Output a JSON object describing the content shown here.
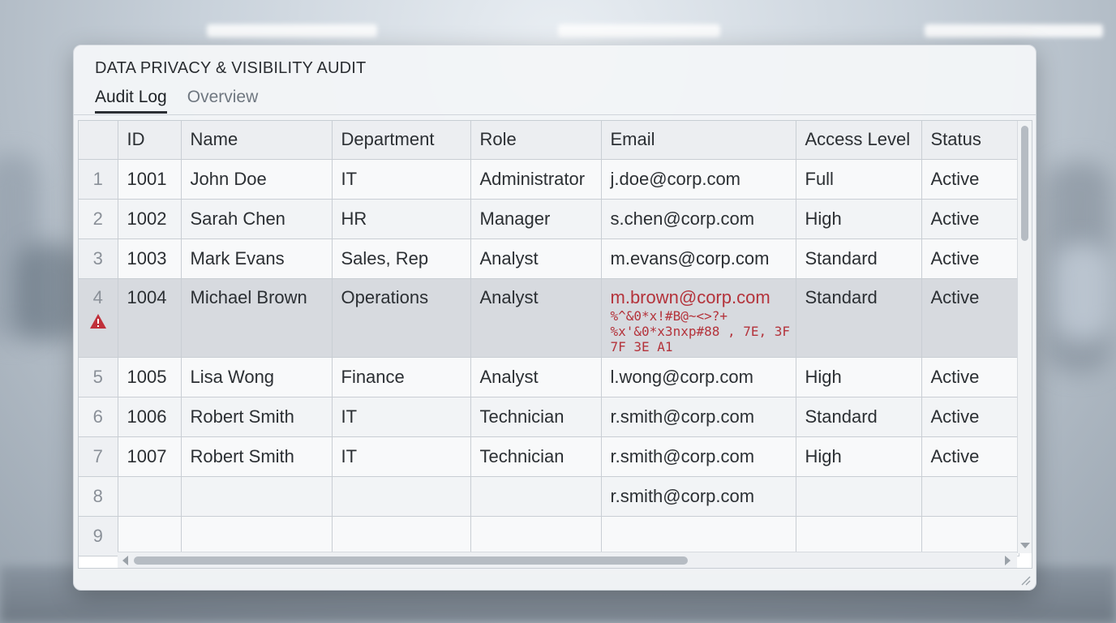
{
  "window": {
    "title": "DATA PRIVACY & VISIBILITY AUDIT"
  },
  "tabs": [
    {
      "label": "Audit Log",
      "active": true
    },
    {
      "label": "Overview",
      "active": false
    }
  ],
  "table": {
    "columns": [
      "",
      "ID",
      "Name",
      "Department",
      "Role",
      "Email",
      "Access Level",
      "Status"
    ],
    "rows": [
      {
        "num": "1",
        "id": "1001",
        "name": "John Doe",
        "department": "IT",
        "role": "Administrator",
        "email": "j.doe@corp.com",
        "access": "Full",
        "status": "Active"
      },
      {
        "num": "2",
        "id": "1002",
        "name": "Sarah Chen",
        "department": "HR",
        "role": "Manager",
        "email": "s.chen@corp.com",
        "access": "High",
        "status": "Active"
      },
      {
        "num": "3",
        "id": "1003",
        "name": "Mark Evans",
        "department": "Sales, Rep",
        "role": "Analyst",
        "email": "m.evans@corp.com",
        "access": "Standard",
        "status": "Active"
      },
      {
        "num": "4",
        "id": "1004",
        "name": "Michael Brown",
        "department": "Operations",
        "role": "Analyst",
        "email": "m.brown@corp.com",
        "access": "Standard",
        "status": "Active",
        "warning": true,
        "corrupt_lines": [
          "%^&0*x!#B@~<>?+",
          "%x'&0*x3nxp#88 , 7E, 3F",
          "7F 3E A1"
        ]
      },
      {
        "num": "5",
        "id": "1005",
        "name": "Lisa Wong",
        "department": "Finance",
        "role": "Analyst",
        "email": "l.wong@corp.com",
        "access": "High",
        "status": "Active"
      },
      {
        "num": "6",
        "id": "1006",
        "name": "Robert Smith",
        "department": "IT",
        "role": "Technician",
        "email": "r.smith@corp.com",
        "access": "Standard",
        "status": "Active"
      },
      {
        "num": "7",
        "id": "1007",
        "name": "Robert Smith",
        "department": "IT",
        "role": "Technician",
        "email": "r.smith@corp.com",
        "access": "High",
        "status": "Active"
      },
      {
        "num": "8",
        "id": "",
        "name": "",
        "department": "",
        "role": "",
        "email": "r.smith@corp.com",
        "access": "",
        "status": ""
      },
      {
        "num": "9",
        "id": "",
        "name": "",
        "department": "",
        "role": "",
        "email": "",
        "access": "",
        "status": ""
      }
    ]
  },
  "icons": {
    "warning": "warning-triangle-icon",
    "resize": "resize-grip-icon"
  },
  "colors": {
    "warning": "#c0303a",
    "corrupt_text": "#b4333b",
    "highlight_row": "#d7dadf"
  }
}
